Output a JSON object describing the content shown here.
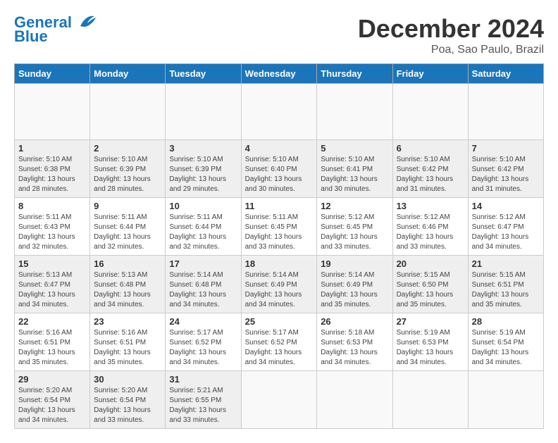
{
  "header": {
    "logo_line1": "General",
    "logo_line2": "Blue",
    "main_title": "December 2024",
    "subtitle": "Poa, Sao Paulo, Brazil"
  },
  "calendar": {
    "days_of_week": [
      "Sunday",
      "Monday",
      "Tuesday",
      "Wednesday",
      "Thursday",
      "Friday",
      "Saturday"
    ],
    "weeks": [
      [
        {
          "day": "",
          "info": ""
        },
        {
          "day": "",
          "info": ""
        },
        {
          "day": "",
          "info": ""
        },
        {
          "day": "",
          "info": ""
        },
        {
          "day": "",
          "info": ""
        },
        {
          "day": "",
          "info": ""
        },
        {
          "day": "",
          "info": ""
        }
      ],
      [
        {
          "day": "1",
          "info": "Sunrise: 5:10 AM\nSunset: 6:38 PM\nDaylight: 13 hours\nand 28 minutes."
        },
        {
          "day": "2",
          "info": "Sunrise: 5:10 AM\nSunset: 6:39 PM\nDaylight: 13 hours\nand 28 minutes."
        },
        {
          "day": "3",
          "info": "Sunrise: 5:10 AM\nSunset: 6:39 PM\nDaylight: 13 hours\nand 29 minutes."
        },
        {
          "day": "4",
          "info": "Sunrise: 5:10 AM\nSunset: 6:40 PM\nDaylight: 13 hours\nand 30 minutes."
        },
        {
          "day": "5",
          "info": "Sunrise: 5:10 AM\nSunset: 6:41 PM\nDaylight: 13 hours\nand 30 minutes."
        },
        {
          "day": "6",
          "info": "Sunrise: 5:10 AM\nSunset: 6:42 PM\nDaylight: 13 hours\nand 31 minutes."
        },
        {
          "day": "7",
          "info": "Sunrise: 5:10 AM\nSunset: 6:42 PM\nDaylight: 13 hours\nand 31 minutes."
        }
      ],
      [
        {
          "day": "8",
          "info": "Sunrise: 5:11 AM\nSunset: 6:43 PM\nDaylight: 13 hours\nand 32 minutes."
        },
        {
          "day": "9",
          "info": "Sunrise: 5:11 AM\nSunset: 6:44 PM\nDaylight: 13 hours\nand 32 minutes."
        },
        {
          "day": "10",
          "info": "Sunrise: 5:11 AM\nSunset: 6:44 PM\nDaylight: 13 hours\nand 32 minutes."
        },
        {
          "day": "11",
          "info": "Sunrise: 5:11 AM\nSunset: 6:45 PM\nDaylight: 13 hours\nand 33 minutes."
        },
        {
          "day": "12",
          "info": "Sunrise: 5:12 AM\nSunset: 6:45 PM\nDaylight: 13 hours\nand 33 minutes."
        },
        {
          "day": "13",
          "info": "Sunrise: 5:12 AM\nSunset: 6:46 PM\nDaylight: 13 hours\nand 33 minutes."
        },
        {
          "day": "14",
          "info": "Sunrise: 5:12 AM\nSunset: 6:47 PM\nDaylight: 13 hours\nand 34 minutes."
        }
      ],
      [
        {
          "day": "15",
          "info": "Sunrise: 5:13 AM\nSunset: 6:47 PM\nDaylight: 13 hours\nand 34 minutes."
        },
        {
          "day": "16",
          "info": "Sunrise: 5:13 AM\nSunset: 6:48 PM\nDaylight: 13 hours\nand 34 minutes."
        },
        {
          "day": "17",
          "info": "Sunrise: 5:14 AM\nSunset: 6:48 PM\nDaylight: 13 hours\nand 34 minutes."
        },
        {
          "day": "18",
          "info": "Sunrise: 5:14 AM\nSunset: 6:49 PM\nDaylight: 13 hours\nand 34 minutes."
        },
        {
          "day": "19",
          "info": "Sunrise: 5:14 AM\nSunset: 6:49 PM\nDaylight: 13 hours\nand 35 minutes."
        },
        {
          "day": "20",
          "info": "Sunrise: 5:15 AM\nSunset: 6:50 PM\nDaylight: 13 hours\nand 35 minutes."
        },
        {
          "day": "21",
          "info": "Sunrise: 5:15 AM\nSunset: 6:51 PM\nDaylight: 13 hours\nand 35 minutes."
        }
      ],
      [
        {
          "day": "22",
          "info": "Sunrise: 5:16 AM\nSunset: 6:51 PM\nDaylight: 13 hours\nand 35 minutes."
        },
        {
          "day": "23",
          "info": "Sunrise: 5:16 AM\nSunset: 6:51 PM\nDaylight: 13 hours\nand 35 minutes."
        },
        {
          "day": "24",
          "info": "Sunrise: 5:17 AM\nSunset: 6:52 PM\nDaylight: 13 hours\nand 34 minutes."
        },
        {
          "day": "25",
          "info": "Sunrise: 5:17 AM\nSunset: 6:52 PM\nDaylight: 13 hours\nand 34 minutes."
        },
        {
          "day": "26",
          "info": "Sunrise: 5:18 AM\nSunset: 6:53 PM\nDaylight: 13 hours\nand 34 minutes."
        },
        {
          "day": "27",
          "info": "Sunrise: 5:19 AM\nSunset: 6:53 PM\nDaylight: 13 hours\nand 34 minutes."
        },
        {
          "day": "28",
          "info": "Sunrise: 5:19 AM\nSunset: 6:54 PM\nDaylight: 13 hours\nand 34 minutes."
        }
      ],
      [
        {
          "day": "29",
          "info": "Sunrise: 5:20 AM\nSunset: 6:54 PM\nDaylight: 13 hours\nand 34 minutes."
        },
        {
          "day": "30",
          "info": "Sunrise: 5:20 AM\nSunset: 6:54 PM\nDaylight: 13 hours\nand 33 minutes."
        },
        {
          "day": "31",
          "info": "Sunrise: 5:21 AM\nSunset: 6:55 PM\nDaylight: 13 hours\nand 33 minutes."
        },
        {
          "day": "",
          "info": ""
        },
        {
          "day": "",
          "info": ""
        },
        {
          "day": "",
          "info": ""
        },
        {
          "day": "",
          "info": ""
        }
      ]
    ]
  }
}
